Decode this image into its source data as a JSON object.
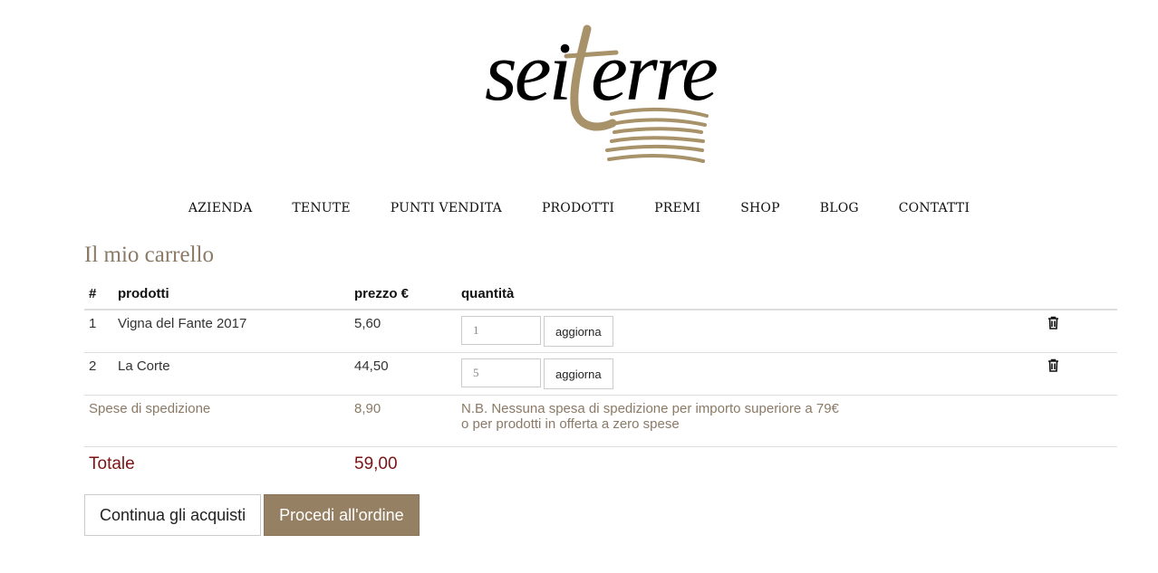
{
  "logo": {
    "text": "seiterre",
    "colors": {
      "dark": "#000000",
      "gold": "#a8926a"
    }
  },
  "nav": {
    "items": [
      "AZIENDA",
      "TENUTE",
      "PUNTI VENDITA",
      "PRODOTTI",
      "PREMI",
      "SHOP",
      "BLOG",
      "CONTATTI"
    ]
  },
  "cart": {
    "title": "Il mio carrello",
    "headers": {
      "num": "#",
      "product": "prodotti",
      "price": "prezzo €",
      "qty": "quantità"
    },
    "items": [
      {
        "num": "1",
        "product": "Vigna del Fante 2017",
        "price": "5,60",
        "qty": "1",
        "update_label": "aggiorna",
        "remove_icon": "trash-icon"
      },
      {
        "num": "2",
        "product": "La Corte",
        "price": "44,50",
        "qty": "5",
        "update_label": "aggiorna",
        "remove_icon": "trash-icon"
      }
    ],
    "shipping": {
      "label": "Spese di spedizione",
      "price": "8,90",
      "note_line1": "N.B. Nessuna spesa di spedizione per importo superiore a 79€",
      "note_line2": "o per prodotti in offerta a zero spese"
    },
    "total": {
      "label": "Totale",
      "value": "59,00"
    }
  },
  "actions": {
    "continue_label": "Continua gli acquisti",
    "proceed_label": "Procedi all'ordine"
  },
  "colors": {
    "accent": "#968063",
    "title": "#8a7a66",
    "total": "#7a1414"
  }
}
